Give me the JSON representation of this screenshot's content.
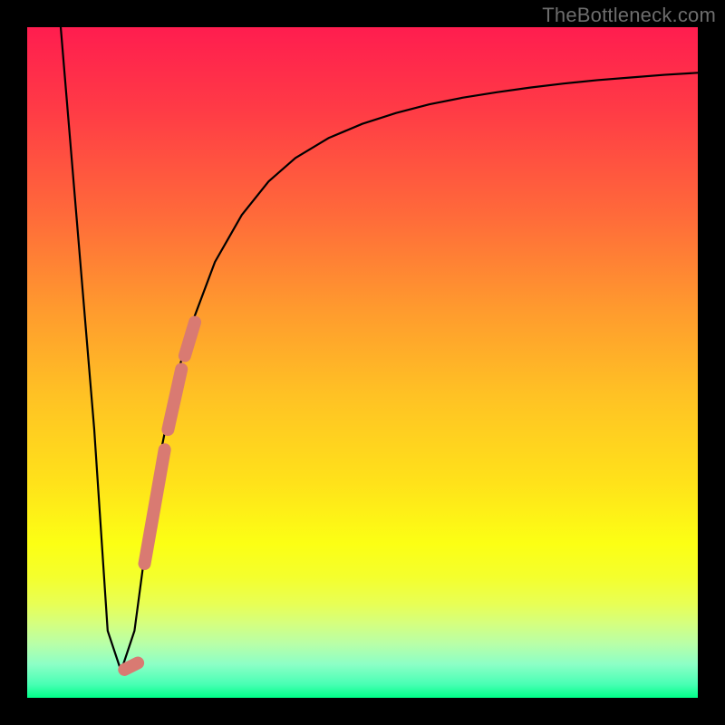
{
  "watermark": "TheBottleneck.com",
  "colors": {
    "frame": "#000000",
    "curve": "#000000",
    "marker_fill": "#d97a72",
    "marker_stroke": "#a85a55"
  },
  "chart_data": {
    "type": "line",
    "title": "",
    "xlabel": "",
    "ylabel": "",
    "xlim": [
      0,
      100
    ],
    "ylim": [
      0,
      100
    ],
    "grid": false,
    "series": [
      {
        "name": "bottleneck-curve",
        "x": [
          5,
          10,
          12,
          14,
          16,
          18,
          20,
          22,
          25,
          28,
          32,
          36,
          40,
          45,
          50,
          55,
          60,
          65,
          70,
          75,
          80,
          85,
          90,
          95,
          100
        ],
        "y": [
          100,
          40,
          10,
          4,
          10,
          25,
          37,
          47,
          57,
          65,
          72,
          77,
          80.5,
          83.5,
          85.6,
          87.2,
          88.5,
          89.5,
          90.3,
          91.0,
          91.6,
          92.1,
          92.5,
          92.9,
          93.2
        ]
      }
    ],
    "markers": [
      {
        "name": "segment-1",
        "x1": 14.5,
        "y1": 4.2,
        "x2": 16.5,
        "y2": 5.2,
        "width": 14
      },
      {
        "name": "segment-2",
        "x1": 17.5,
        "y1": 20,
        "x2": 20.5,
        "y2": 37,
        "width": 14
      },
      {
        "name": "segment-3",
        "x1": 21.0,
        "y1": 40,
        "x2": 23.0,
        "y2": 49,
        "width": 14
      },
      {
        "name": "segment-4",
        "x1": 23.5,
        "y1": 51,
        "x2": 25.0,
        "y2": 56,
        "width": 14
      }
    ]
  }
}
